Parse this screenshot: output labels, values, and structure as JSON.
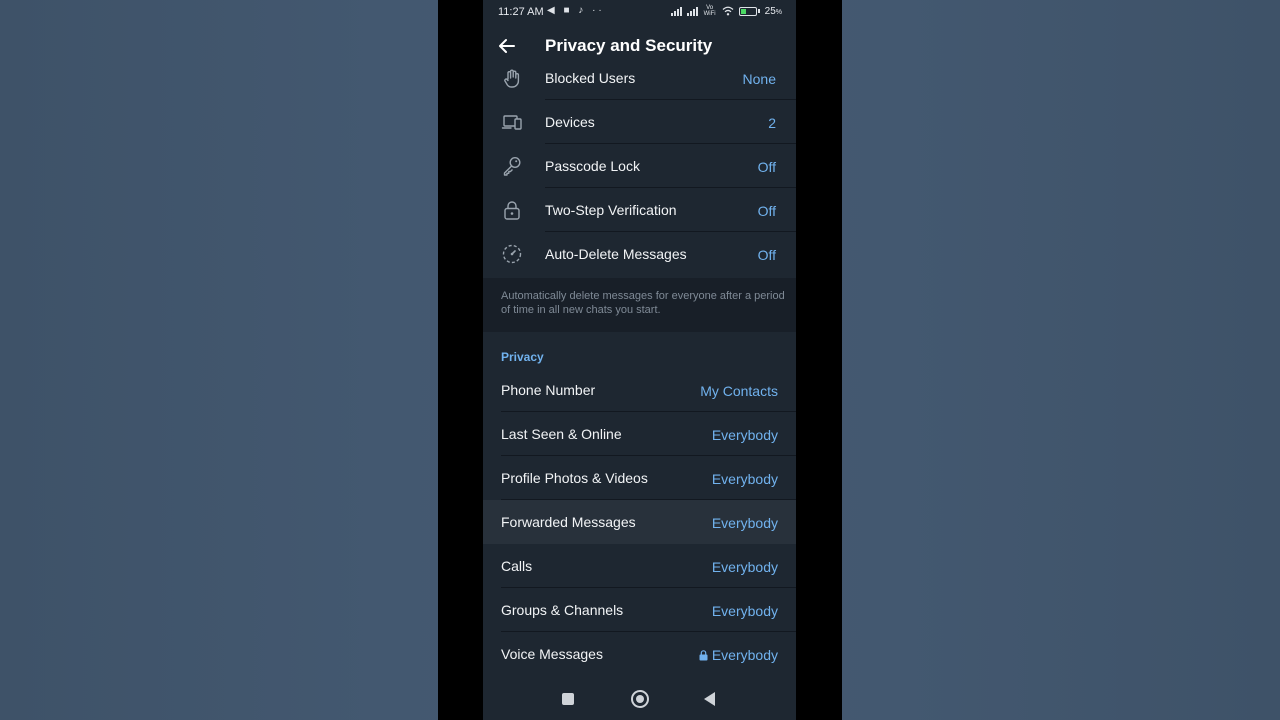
{
  "status_bar": {
    "time": "11:27 AM",
    "left_icons": "◀ ■ ♪ ··",
    "volte": "Vo WiFi",
    "battery": "25"
  },
  "header": {
    "title": "Privacy and Security"
  },
  "security_items": [
    {
      "icon": "hand-icon",
      "label": "Blocked Users",
      "value": "None"
    },
    {
      "icon": "devices-icon",
      "label": "Devices",
      "value": "2"
    },
    {
      "icon": "key-icon",
      "label": "Passcode Lock",
      "value": "Off"
    },
    {
      "icon": "lock-icon",
      "label": "Two-Step Verification",
      "value": "Off"
    },
    {
      "icon": "timer-icon",
      "label": "Auto-Delete Messages",
      "value": "Off"
    }
  ],
  "auto_delete_hint": "Automatically delete messages for everyone after a period of time in all new chats you start.",
  "privacy": {
    "title": "Privacy",
    "items": [
      {
        "label": "Phone Number",
        "value": "My Contacts"
      },
      {
        "label": "Last Seen & Online",
        "value": "Everybody"
      },
      {
        "label": "Profile Photos & Videos",
        "value": "Everybody"
      },
      {
        "label": "Forwarded Messages",
        "value": "Everybody"
      },
      {
        "label": "Calls",
        "value": "Everybody"
      },
      {
        "label": "Groups & Channels",
        "value": "Everybody"
      },
      {
        "label": "Voice Messages",
        "value": "Everybody"
      }
    ]
  },
  "colors": {
    "accent": "#71b2ee",
    "background": "#181f28",
    "surface": "#1e2731"
  }
}
